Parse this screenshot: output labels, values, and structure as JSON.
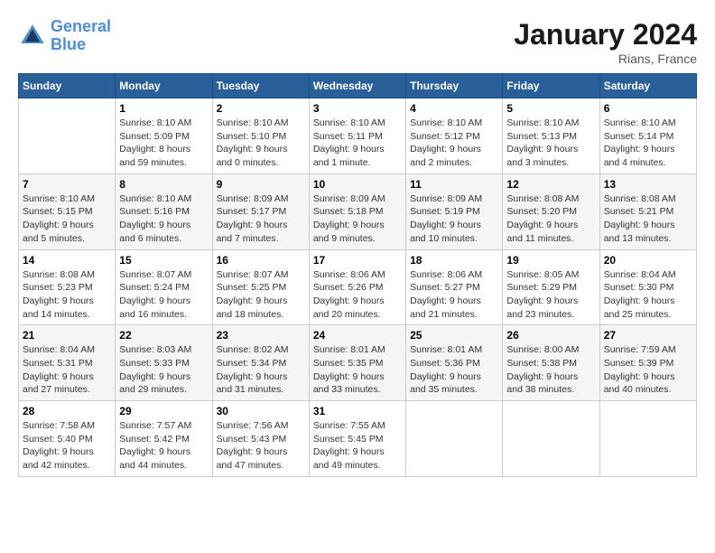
{
  "header": {
    "logo_line1": "General",
    "logo_line2": "Blue",
    "month_title": "January 2024",
    "location": "Rians, France"
  },
  "weekdays": [
    "Sunday",
    "Monday",
    "Tuesday",
    "Wednesday",
    "Thursday",
    "Friday",
    "Saturday"
  ],
  "weeks": [
    [
      {
        "day": "",
        "sunrise": "",
        "sunset": "",
        "daylight": ""
      },
      {
        "day": "1",
        "sunrise": "Sunrise: 8:10 AM",
        "sunset": "Sunset: 5:09 PM",
        "daylight": "Daylight: 8 hours and 59 minutes."
      },
      {
        "day": "2",
        "sunrise": "Sunrise: 8:10 AM",
        "sunset": "Sunset: 5:10 PM",
        "daylight": "Daylight: 9 hours and 0 minutes."
      },
      {
        "day": "3",
        "sunrise": "Sunrise: 8:10 AM",
        "sunset": "Sunset: 5:11 PM",
        "daylight": "Daylight: 9 hours and 1 minute."
      },
      {
        "day": "4",
        "sunrise": "Sunrise: 8:10 AM",
        "sunset": "Sunset: 5:12 PM",
        "daylight": "Daylight: 9 hours and 2 minutes."
      },
      {
        "day": "5",
        "sunrise": "Sunrise: 8:10 AM",
        "sunset": "Sunset: 5:13 PM",
        "daylight": "Daylight: 9 hours and 3 minutes."
      },
      {
        "day": "6",
        "sunrise": "Sunrise: 8:10 AM",
        "sunset": "Sunset: 5:14 PM",
        "daylight": "Daylight: 9 hours and 4 minutes."
      }
    ],
    [
      {
        "day": "7",
        "sunrise": "Sunrise: 8:10 AM",
        "sunset": "Sunset: 5:15 PM",
        "daylight": "Daylight: 9 hours and 5 minutes."
      },
      {
        "day": "8",
        "sunrise": "Sunrise: 8:10 AM",
        "sunset": "Sunset: 5:16 PM",
        "daylight": "Daylight: 9 hours and 6 minutes."
      },
      {
        "day": "9",
        "sunrise": "Sunrise: 8:09 AM",
        "sunset": "Sunset: 5:17 PM",
        "daylight": "Daylight: 9 hours and 7 minutes."
      },
      {
        "day": "10",
        "sunrise": "Sunrise: 8:09 AM",
        "sunset": "Sunset: 5:18 PM",
        "daylight": "Daylight: 9 hours and 9 minutes."
      },
      {
        "day": "11",
        "sunrise": "Sunrise: 8:09 AM",
        "sunset": "Sunset: 5:19 PM",
        "daylight": "Daylight: 9 hours and 10 minutes."
      },
      {
        "day": "12",
        "sunrise": "Sunrise: 8:08 AM",
        "sunset": "Sunset: 5:20 PM",
        "daylight": "Daylight: 9 hours and 11 minutes."
      },
      {
        "day": "13",
        "sunrise": "Sunrise: 8:08 AM",
        "sunset": "Sunset: 5:21 PM",
        "daylight": "Daylight: 9 hours and 13 minutes."
      }
    ],
    [
      {
        "day": "14",
        "sunrise": "Sunrise: 8:08 AM",
        "sunset": "Sunset: 5:23 PM",
        "daylight": "Daylight: 9 hours and 14 minutes."
      },
      {
        "day": "15",
        "sunrise": "Sunrise: 8:07 AM",
        "sunset": "Sunset: 5:24 PM",
        "daylight": "Daylight: 9 hours and 16 minutes."
      },
      {
        "day": "16",
        "sunrise": "Sunrise: 8:07 AM",
        "sunset": "Sunset: 5:25 PM",
        "daylight": "Daylight: 9 hours and 18 minutes."
      },
      {
        "day": "17",
        "sunrise": "Sunrise: 8:06 AM",
        "sunset": "Sunset: 5:26 PM",
        "daylight": "Daylight: 9 hours and 20 minutes."
      },
      {
        "day": "18",
        "sunrise": "Sunrise: 8:06 AM",
        "sunset": "Sunset: 5:27 PM",
        "daylight": "Daylight: 9 hours and 21 minutes."
      },
      {
        "day": "19",
        "sunrise": "Sunrise: 8:05 AM",
        "sunset": "Sunset: 5:29 PM",
        "daylight": "Daylight: 9 hours and 23 minutes."
      },
      {
        "day": "20",
        "sunrise": "Sunrise: 8:04 AM",
        "sunset": "Sunset: 5:30 PM",
        "daylight": "Daylight: 9 hours and 25 minutes."
      }
    ],
    [
      {
        "day": "21",
        "sunrise": "Sunrise: 8:04 AM",
        "sunset": "Sunset: 5:31 PM",
        "daylight": "Daylight: 9 hours and 27 minutes."
      },
      {
        "day": "22",
        "sunrise": "Sunrise: 8:03 AM",
        "sunset": "Sunset: 5:33 PM",
        "daylight": "Daylight: 9 hours and 29 minutes."
      },
      {
        "day": "23",
        "sunrise": "Sunrise: 8:02 AM",
        "sunset": "Sunset: 5:34 PM",
        "daylight": "Daylight: 9 hours and 31 minutes."
      },
      {
        "day": "24",
        "sunrise": "Sunrise: 8:01 AM",
        "sunset": "Sunset: 5:35 PM",
        "daylight": "Daylight: 9 hours and 33 minutes."
      },
      {
        "day": "25",
        "sunrise": "Sunrise: 8:01 AM",
        "sunset": "Sunset: 5:36 PM",
        "daylight": "Daylight: 9 hours and 35 minutes."
      },
      {
        "day": "26",
        "sunrise": "Sunrise: 8:00 AM",
        "sunset": "Sunset: 5:38 PM",
        "daylight": "Daylight: 9 hours and 38 minutes."
      },
      {
        "day": "27",
        "sunrise": "Sunrise: 7:59 AM",
        "sunset": "Sunset: 5:39 PM",
        "daylight": "Daylight: 9 hours and 40 minutes."
      }
    ],
    [
      {
        "day": "28",
        "sunrise": "Sunrise: 7:58 AM",
        "sunset": "Sunset: 5:40 PM",
        "daylight": "Daylight: 9 hours and 42 minutes."
      },
      {
        "day": "29",
        "sunrise": "Sunrise: 7:57 AM",
        "sunset": "Sunset: 5:42 PM",
        "daylight": "Daylight: 9 hours and 44 minutes."
      },
      {
        "day": "30",
        "sunrise": "Sunrise: 7:56 AM",
        "sunset": "Sunset: 5:43 PM",
        "daylight": "Daylight: 9 hours and 47 minutes."
      },
      {
        "day": "31",
        "sunrise": "Sunrise: 7:55 AM",
        "sunset": "Sunset: 5:45 PM",
        "daylight": "Daylight: 9 hours and 49 minutes."
      },
      {
        "day": "",
        "sunrise": "",
        "sunset": "",
        "daylight": ""
      },
      {
        "day": "",
        "sunrise": "",
        "sunset": "",
        "daylight": ""
      },
      {
        "day": "",
        "sunrise": "",
        "sunset": "",
        "daylight": ""
      }
    ]
  ]
}
